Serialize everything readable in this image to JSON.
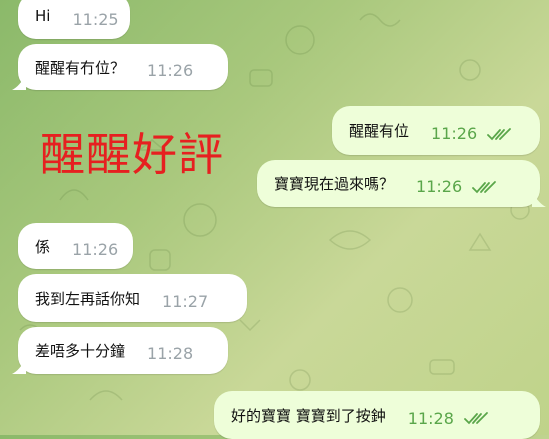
{
  "colors": {
    "incoming_bubble": "#ffffff",
    "outgoing_bubble": "#eefed9",
    "time_in": "#9aa3a8",
    "time_out": "#5aa64a",
    "overlay_text": "#e62020"
  },
  "overlay_caption": "醒醒好評",
  "messages": [
    {
      "direction": "in",
      "text": "Hi",
      "time": "11:25"
    },
    {
      "direction": "in",
      "text": "醒醒有冇位？",
      "time": "11:26"
    },
    {
      "direction": "out",
      "text": "醒醒有位",
      "time": "11:26",
      "status": "read-double-check-icon"
    },
    {
      "direction": "out",
      "text": "寶寶現在過來嗎？",
      "time": "11:26",
      "status": "read-double-check-icon"
    },
    {
      "direction": "in",
      "text": "係",
      "time": "11:26"
    },
    {
      "direction": "in",
      "text": "我到左再話你知",
      "time": "11:27"
    },
    {
      "direction": "in",
      "text": "差唔多十分鐘",
      "time": "11:28"
    },
    {
      "direction": "out",
      "text": "好的寶寶 寶寶到了按鈡",
      "time": "11:28",
      "status": "read-double-check-icon"
    }
  ]
}
